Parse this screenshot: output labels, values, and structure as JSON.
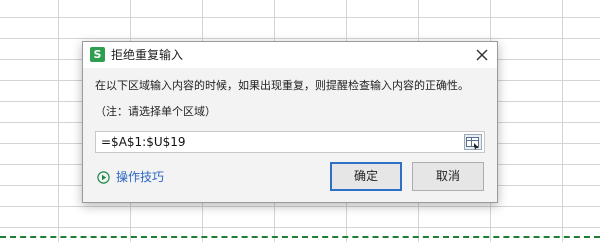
{
  "dialog": {
    "title": "拒绝重复输入",
    "app_icon_letter": "S",
    "prompt": "在以下区域输入内容的时候，如果出现重复，则提醒检查输入内容的正确性。",
    "note": "（注：请选择单个区域）",
    "range_value": "=$A$1:$U$19",
    "help_label": "操作技巧",
    "ok_label": "确定",
    "cancel_label": "取消",
    "icons": {
      "app": "wps-spreadsheet-icon",
      "close": "close-icon",
      "range_picker": "range-select-icon",
      "help": "play-circle-icon"
    },
    "colors": {
      "accent": "#2f6fc5",
      "link": "#2a66c4",
      "app_icon": "#2e9e4f",
      "selection_border": "#1e7e34"
    }
  }
}
